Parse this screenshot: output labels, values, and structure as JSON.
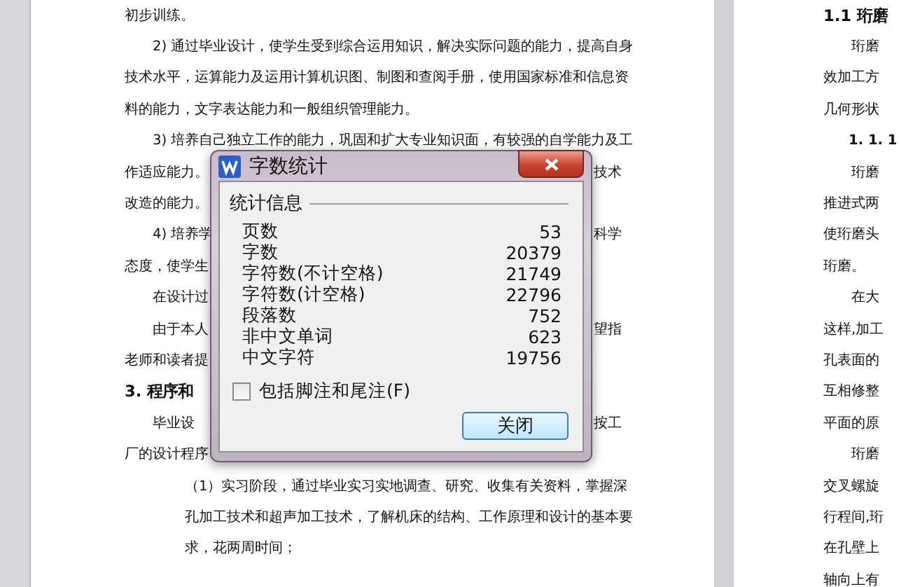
{
  "left_page": {
    "lines": [
      {
        "kind": "para",
        "text": "初步训练。"
      },
      {
        "kind": "para-start",
        "text": "2) 通过毕业设计，使学生受到综合运用知识，解决实际问题的能力，提高自身"
      },
      {
        "kind": "para",
        "text": "技术水平，运算能力及运用计算机识图、制图和查阅手册，使用国家标准和信息资"
      },
      {
        "kind": "para",
        "text": "料的能力，文字表达能力和一般组织管理能力。"
      },
      {
        "kind": "para-start",
        "text": "3) 培养自己独立工作的能力，巩固和扩大专业知识面，有较强的自学能力及工"
      },
      {
        "kind": "para",
        "text": "作适应能力。",
        "right_text": "技术"
      },
      {
        "kind": "para",
        "text": "改造的能力。"
      },
      {
        "kind": "para-start",
        "text": "4) 培养学",
        "right_text": "科学"
      },
      {
        "kind": "para",
        "text": "态度，使学生"
      },
      {
        "kind": "para-start",
        "text": "在设计过"
      },
      {
        "kind": "para-start",
        "text": "由于本人",
        "right_text": "望指"
      },
      {
        "kind": "para",
        "text": "老师和读者提"
      },
      {
        "kind": "heading",
        "text": "3. 程序和"
      },
      {
        "kind": "para-start",
        "text": "毕业设",
        "right_text": "按工"
      },
      {
        "kind": "para",
        "text": "厂的设计程序"
      },
      {
        "kind": "list",
        "text": "（1）实习阶段，通过毕业实习实地调查、研究、收集有关资料，掌握深"
      },
      {
        "kind": "list",
        "text": "孔加工技术和超声加工技术，了解机床的结构、工作原理和设计的基本要"
      },
      {
        "kind": "list",
        "text": "求，花两周时间；"
      }
    ]
  },
  "right_page": {
    "lines": [
      {
        "kind": "heading",
        "text": "1.1 珩磨"
      },
      {
        "kind": "para-start",
        "text": "珩磨"
      },
      {
        "kind": "para",
        "text": "效加工方"
      },
      {
        "kind": "para",
        "text": "几何形状"
      },
      {
        "kind": "subheading",
        "text": "1. 1. 1"
      },
      {
        "kind": "para-start",
        "text": "珩磨"
      },
      {
        "kind": "para",
        "text": "推进式两"
      },
      {
        "kind": "para",
        "text": "使珩磨头"
      },
      {
        "kind": "para",
        "text": "珩磨。"
      },
      {
        "kind": "para-start",
        "text": "在大"
      },
      {
        "kind": "para",
        "text": "这样,加工"
      },
      {
        "kind": "para",
        "text": "孔表面的"
      },
      {
        "kind": "para",
        "text": "互相修整"
      },
      {
        "kind": "para",
        "text": "平面的原"
      },
      {
        "kind": "para-start",
        "text": "珩磨"
      },
      {
        "kind": "para",
        "text": "交叉螺旋"
      },
      {
        "kind": "para",
        "text": "行程间,珩"
      },
      {
        "kind": "para",
        "text": "在孔壁上"
      },
      {
        "kind": "para",
        "text": "轴向上有"
      }
    ]
  },
  "dialog": {
    "title": "字数统计",
    "group_title": "统计信息",
    "stats": [
      {
        "label": "页数",
        "value": "53"
      },
      {
        "label": "字数",
        "value": "20379"
      },
      {
        "label": "字符数(不计空格)",
        "value": "21749"
      },
      {
        "label": "字符数(计空格)",
        "value": "22796"
      },
      {
        "label": "段落数",
        "value": "752"
      },
      {
        "label": "非中文单词",
        "value": "623"
      },
      {
        "label": "中文字符",
        "value": "19756"
      }
    ],
    "checkbox": {
      "label": "包括脚注和尾注(F)",
      "checked": false
    },
    "button": "关闭"
  }
}
